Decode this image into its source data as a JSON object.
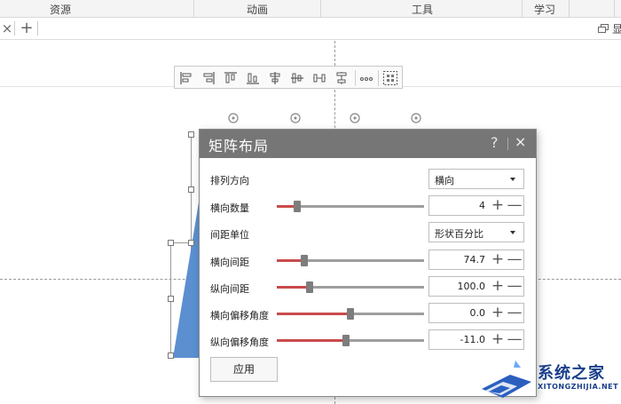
{
  "menubar": {
    "items": [
      "资源",
      "动画",
      "工具",
      "学习"
    ]
  },
  "tabstrip": {
    "close_glyph": "×",
    "add_glyph": "+",
    "right_glyph": "显"
  },
  "dialog": {
    "title": "矩阵布局",
    "help_glyph": "?",
    "close_glyph": "×",
    "rows": [
      {
        "label": "排列方向",
        "type": "dropdown",
        "value": "横向"
      },
      {
        "label": "横向数量",
        "type": "slider",
        "fraction": 0.12,
        "value": "4"
      },
      {
        "label": "间距单位",
        "type": "dropdown",
        "value": "形状百分比"
      },
      {
        "label": "横向间距",
        "type": "slider",
        "fraction": 0.17,
        "value": "74.7"
      },
      {
        "label": "纵向间距",
        "type": "slider",
        "fraction": 0.21,
        "value": "100.0"
      },
      {
        "label": "横向偏移角度",
        "type": "slider",
        "fraction": 0.5,
        "value": "0.0"
      },
      {
        "label": "纵向偏移角度",
        "type": "slider",
        "fraction": 0.47,
        "value": "-11.0"
      }
    ],
    "apply_label": "应用",
    "plus_glyph": "+",
    "minus_glyph": "—"
  },
  "watermark": {
    "title": "系统之家",
    "subtitle": "XITONGZHIJIA.NET"
  },
  "colors": {
    "slider_fill": "#c94b4b",
    "titlebar": "#767676",
    "shape_fill": "#5b8fd0",
    "watermark": "#1a3f8a"
  },
  "icons": {
    "align_toolbar": [
      "align-left-icon",
      "align-right-icon",
      "align-top-icon",
      "align-bottom-icon",
      "align-center-horizontal-icon",
      "align-middle-vertical-icon",
      "distribute-horizontal-icon",
      "distribute-vertical-icon",
      "more-icon",
      "matrix-layout-icon"
    ]
  }
}
